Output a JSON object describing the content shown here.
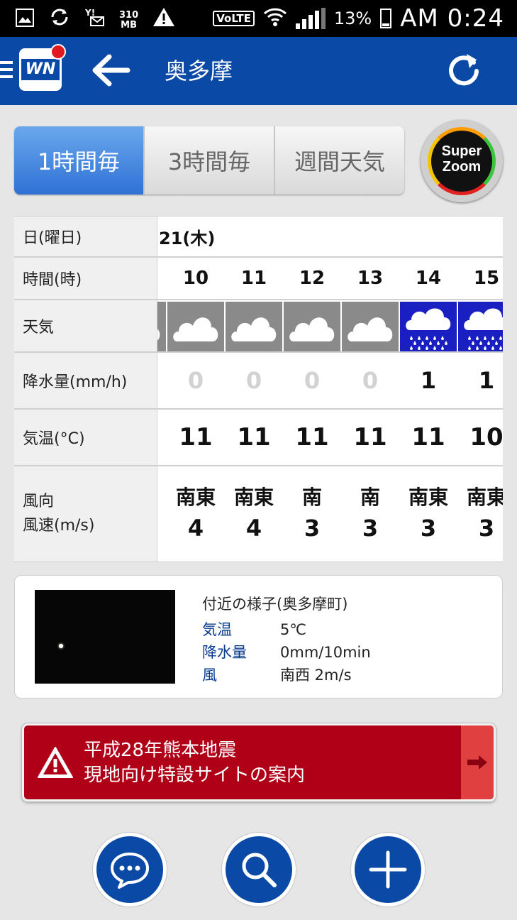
{
  "statusbar": {
    "data_top": "310",
    "data_bottom": "MB",
    "volte": "VoLTE",
    "battery": "13%",
    "time": "AM 0:24"
  },
  "appbar": {
    "logo_text": "WN",
    "title": "奥多摩"
  },
  "tabs": [
    {
      "label": "1時間毎",
      "active": true
    },
    {
      "label": "3時間毎",
      "active": false
    },
    {
      "label": "週間天気",
      "active": false
    }
  ],
  "superzoom": {
    "line1": "Super",
    "line2": "Zoom"
  },
  "forecast": {
    "labels": {
      "day": "日(曜日)",
      "time": "時間(時)",
      "weather": "天気",
      "precip": "降水量(mm/h)",
      "temp": "気温(°C)",
      "wind_line1": "風向",
      "wind_line2": "風速(m/s)"
    },
    "day": "21(木)",
    "hours": [
      {
        "hour": "10",
        "weather": "cloudy-icon",
        "precip": "0",
        "temp": "11",
        "wind_dir": "南東",
        "wind_speed": "4"
      },
      {
        "hour": "11",
        "weather": "cloudy-icon",
        "precip": "0",
        "temp": "11",
        "wind_dir": "南東",
        "wind_speed": "4"
      },
      {
        "hour": "12",
        "weather": "cloudy-icon",
        "precip": "0",
        "temp": "11",
        "wind_dir": "南",
        "wind_speed": "3"
      },
      {
        "hour": "13",
        "weather": "cloudy-icon",
        "precip": "0",
        "temp": "11",
        "wind_dir": "南",
        "wind_speed": "3"
      },
      {
        "hour": "14",
        "weather": "rain-icon",
        "precip": "1",
        "temp": "11",
        "wind_dir": "南東",
        "wind_speed": "3"
      },
      {
        "hour": "15",
        "weather": "rain-icon",
        "precip": "1",
        "temp": "10",
        "wind_dir": "南東",
        "wind_speed": "3"
      }
    ]
  },
  "nearby": {
    "title": "付近の様子(奥多摩町)",
    "rows": [
      {
        "label": "気温",
        "value": "5℃"
      },
      {
        "label": "降水量",
        "value": "0mm/10min"
      },
      {
        "label": "風",
        "value": "南西 2m/s"
      }
    ]
  },
  "alert": {
    "line1": "平成28年熊本地震",
    "line2": "現地向け特設サイトの案内"
  },
  "colors": {
    "appbar": "#0a4aa6",
    "tab_active": "#2f72d6",
    "cloudy_bg": "#8a8a8a",
    "rain_bg": "#1a1fc2",
    "alert": "#b00018"
  },
  "bottom_buttons": [
    "chat-icon",
    "search-icon",
    "add-icon"
  ]
}
